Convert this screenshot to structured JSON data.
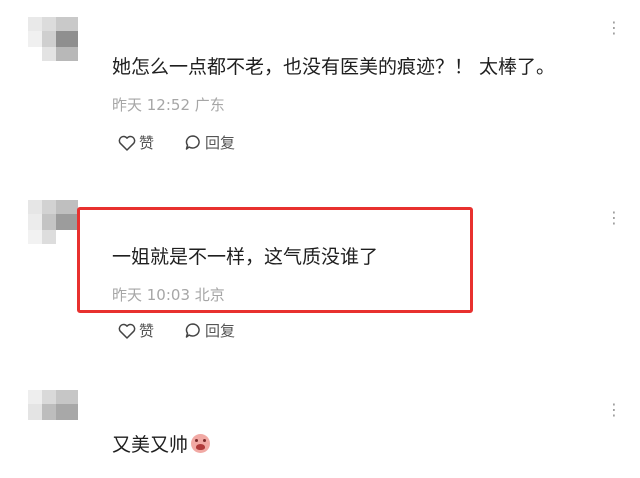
{
  "comments": [
    {
      "text": "她怎么一点都不老，也没有医美的痕迹？！ 太棒了。",
      "time": "昨天 12:52",
      "location": "广东",
      "like_label": "赞",
      "reply_label": "回复"
    },
    {
      "text": "一姐就是不一样，这气质没谁了",
      "time": "昨天 10:03",
      "location": "北京",
      "like_label": "赞",
      "reply_label": "回复"
    },
    {
      "text": "又美又帅",
      "emoji": "crying-face-emoji"
    }
  ],
  "more_glyph": "⋮",
  "colors": {
    "highlight": "#e8312f",
    "meta": "#a6a6a6",
    "text": "#1f1f1f"
  }
}
